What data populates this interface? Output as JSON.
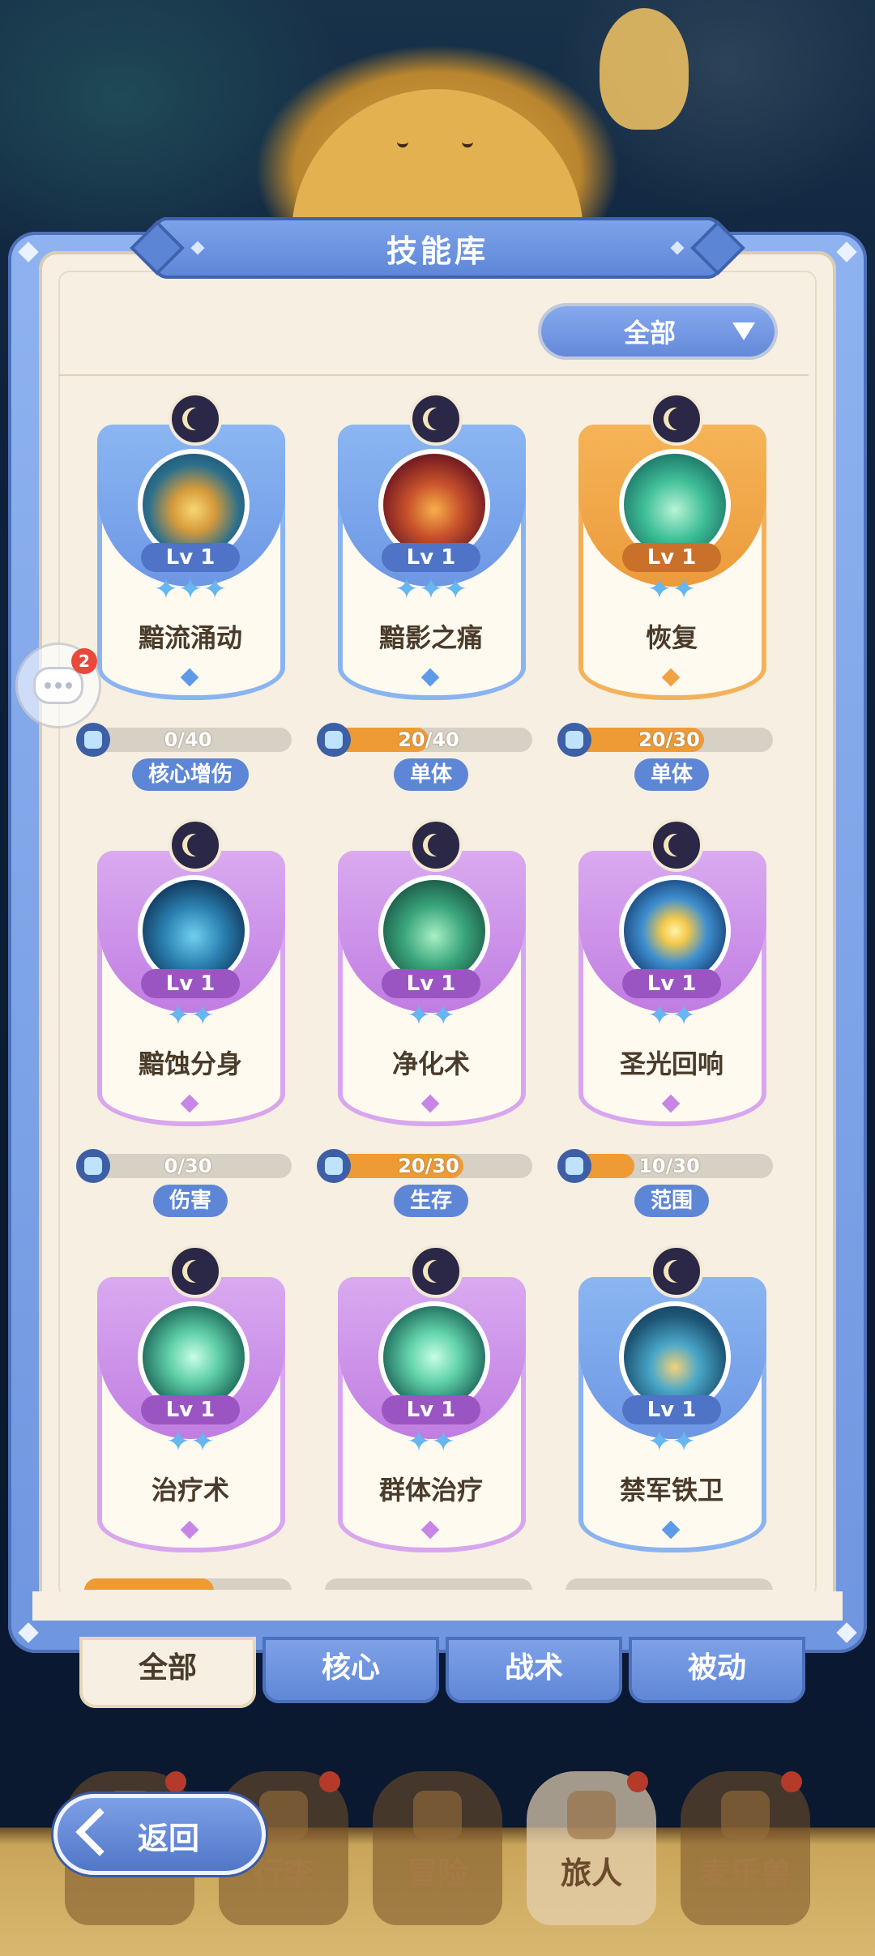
{
  "panel": {
    "title": "技能库"
  },
  "filter": {
    "selected": "全部"
  },
  "chat": {
    "badge_count": "2"
  },
  "skills": [
    {
      "name": "黯流涌动",
      "level": "Lv 1",
      "stars": 3,
      "progress_text": "0/40",
      "progress": 0.0,
      "tag": "核心增伤",
      "rarity": "blue"
    },
    {
      "name": "黯影之痛",
      "level": "Lv 1",
      "stars": 3,
      "progress_text": "20/40",
      "progress": 0.5,
      "tag": "单体",
      "rarity": "blue"
    },
    {
      "name": "恢复",
      "level": "Lv 1",
      "stars": 2,
      "progress_text": "20/30",
      "progress": 0.667,
      "tag": "单体",
      "rarity": "orange"
    },
    {
      "name": "黯蚀分身",
      "level": "Lv 1",
      "stars": 2,
      "progress_text": "0/30",
      "progress": 0.0,
      "tag": "伤害",
      "rarity": "purple"
    },
    {
      "name": "净化术",
      "level": "Lv 1",
      "stars": 2,
      "progress_text": "20/30",
      "progress": 0.667,
      "tag": "生存",
      "rarity": "purple"
    },
    {
      "name": "圣光回响",
      "level": "Lv 1",
      "stars": 2,
      "progress_text": "10/30",
      "progress": 0.333,
      "tag": "范围",
      "rarity": "purple"
    },
    {
      "name": "治疗术",
      "level": "Lv 1",
      "stars": 2,
      "rarity": "purple"
    },
    {
      "name": "群体治疗",
      "level": "Lv 1",
      "stars": 2,
      "rarity": "purple"
    },
    {
      "name": "禁军铁卫",
      "level": "Lv 1",
      "stars": 2,
      "rarity": "blue"
    }
  ],
  "tabs": [
    "全部",
    "核心",
    "战术",
    "被动"
  ],
  "bottom_nav": [
    "行李",
    "冒险",
    "旅人",
    "麦乐兽"
  ],
  "back_button": {
    "label": "返回"
  },
  "colors": {
    "accent_blue": "#5e86d6",
    "progress_orange": "#ee9a35",
    "panel_bg": "#f6efe2"
  }
}
